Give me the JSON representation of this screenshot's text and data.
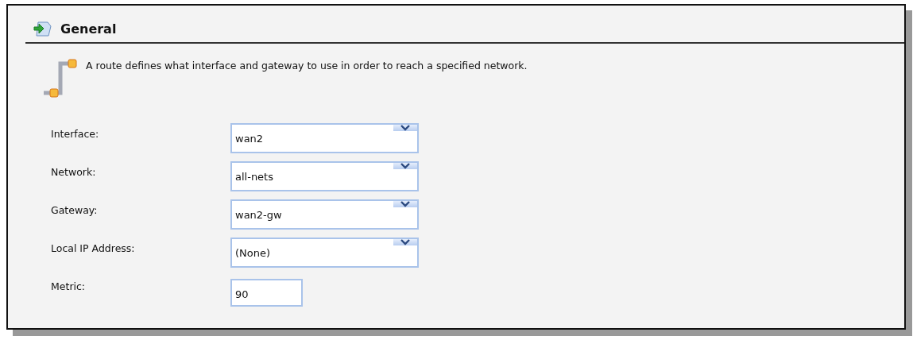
{
  "section": {
    "title": "General",
    "description": "A route defines what interface and gateway to use in order to reach a specified network."
  },
  "fields": [
    {
      "label": "Interface:",
      "kind": "select",
      "value": "wan2"
    },
    {
      "label": "Network:",
      "kind": "select",
      "value": "all-nets"
    },
    {
      "label": "Gateway:",
      "kind": "select",
      "value": "wan2-gw"
    },
    {
      "label": "Local IP Address:",
      "kind": "select",
      "value": "(None)"
    },
    {
      "label": "Metric:",
      "kind": "text",
      "value": "90"
    }
  ]
}
